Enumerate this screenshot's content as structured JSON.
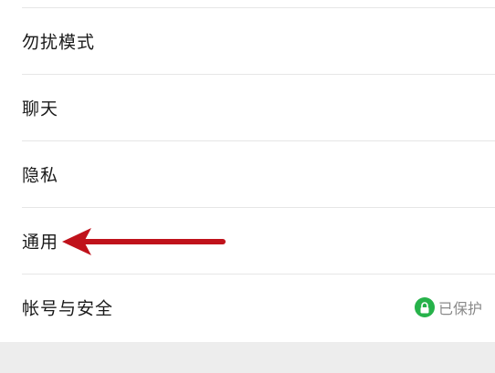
{
  "settings": {
    "items": [
      {
        "label": "勿扰模式"
      },
      {
        "label": "聊天"
      },
      {
        "label": "隐私"
      },
      {
        "label": "通用"
      },
      {
        "label": "帐号与安全",
        "status": "已保护"
      }
    ]
  },
  "colors": {
    "arrow": "#c0121b",
    "protected": "#26b24a"
  },
  "icons": {
    "status": "lock-icon",
    "annotation": "red-arrow-icon"
  }
}
